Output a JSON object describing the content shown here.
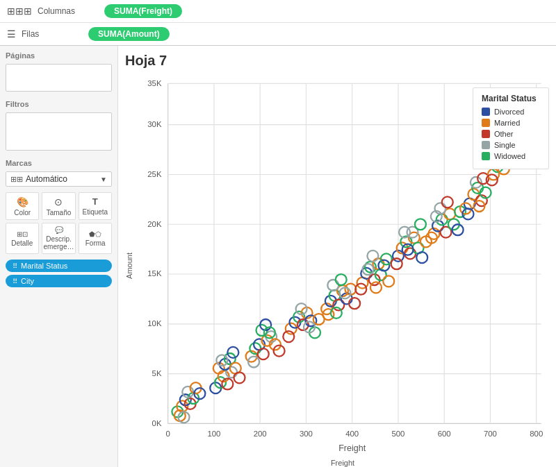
{
  "topBar": {
    "row1": {
      "icon": "⊞⊞⊞",
      "label": "Columnas",
      "pill": "SUMA(Freight)"
    },
    "row2": {
      "icon": "☰",
      "label": "Filas",
      "pill": "SUMA(Amount)"
    }
  },
  "leftPanel": {
    "paginas": {
      "title": "Páginas"
    },
    "filtros": {
      "title": "Filtros"
    },
    "marcas": {
      "title": "Marcas",
      "dropdown": "Automático",
      "buttons": [
        {
          "icon": "🎨",
          "label": "Color"
        },
        {
          "icon": "⊙",
          "label": "Tamaño"
        },
        {
          "icon": "T",
          "label": "Etiqueta"
        },
        {
          "icon": "⊞",
          "label": "Detalle"
        },
        {
          "icon": "💬",
          "label": "Descrip. emerge…"
        },
        {
          "icon": "⬟",
          "label": "Forma"
        }
      ],
      "tags": [
        {
          "label": "Marital Status"
        },
        {
          "label": "City"
        }
      ]
    }
  },
  "chart": {
    "title": "Hoja 7",
    "xAxisLabel": "Freight",
    "yAxisLabel": "Amount",
    "yAxisTicks": [
      "0K",
      "5K",
      "10K",
      "15K",
      "20K",
      "25K",
      "30K",
      "35K"
    ],
    "xAxisTicks": [
      "0",
      "100",
      "200",
      "300",
      "400",
      "500",
      "600",
      "700",
      "800"
    ]
  },
  "legend": {
    "title": "Marital Status",
    "items": [
      {
        "label": "Divorced",
        "color": "#2d4fa1"
      },
      {
        "label": "Married",
        "color": "#e07b1a"
      },
      {
        "label": "Other",
        "color": "#c0392b"
      },
      {
        "label": "Single",
        "color": "#95a5a6"
      },
      {
        "label": "Widowed",
        "color": "#27ae60"
      }
    ]
  }
}
